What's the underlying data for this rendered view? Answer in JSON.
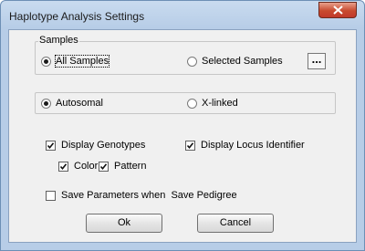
{
  "window": {
    "title": "Haplotype Analysis Settings"
  },
  "samples": {
    "legend": "Samples",
    "all_label": "All Samples",
    "selected_label": "Selected Samples",
    "browse_label": "...",
    "selected_option": "All Samples"
  },
  "inheritance": {
    "autosomal_label": "Autosomal",
    "xlinked_label": "X-linked",
    "selected_option": "Autosomal"
  },
  "display": {
    "genotypes_label": "Display Genotypes",
    "locus_label": "Display Locus Identifier",
    "color_label": "Color",
    "pattern_label": "Pattern",
    "genotypes_checked": true,
    "locus_checked": true,
    "color_checked": true,
    "pattern_checked": true
  },
  "save": {
    "label": "Save Parameters when  Save Pedigree",
    "checked": false
  },
  "buttons": {
    "ok_label": "Ok",
    "cancel_label": "Cancel"
  }
}
